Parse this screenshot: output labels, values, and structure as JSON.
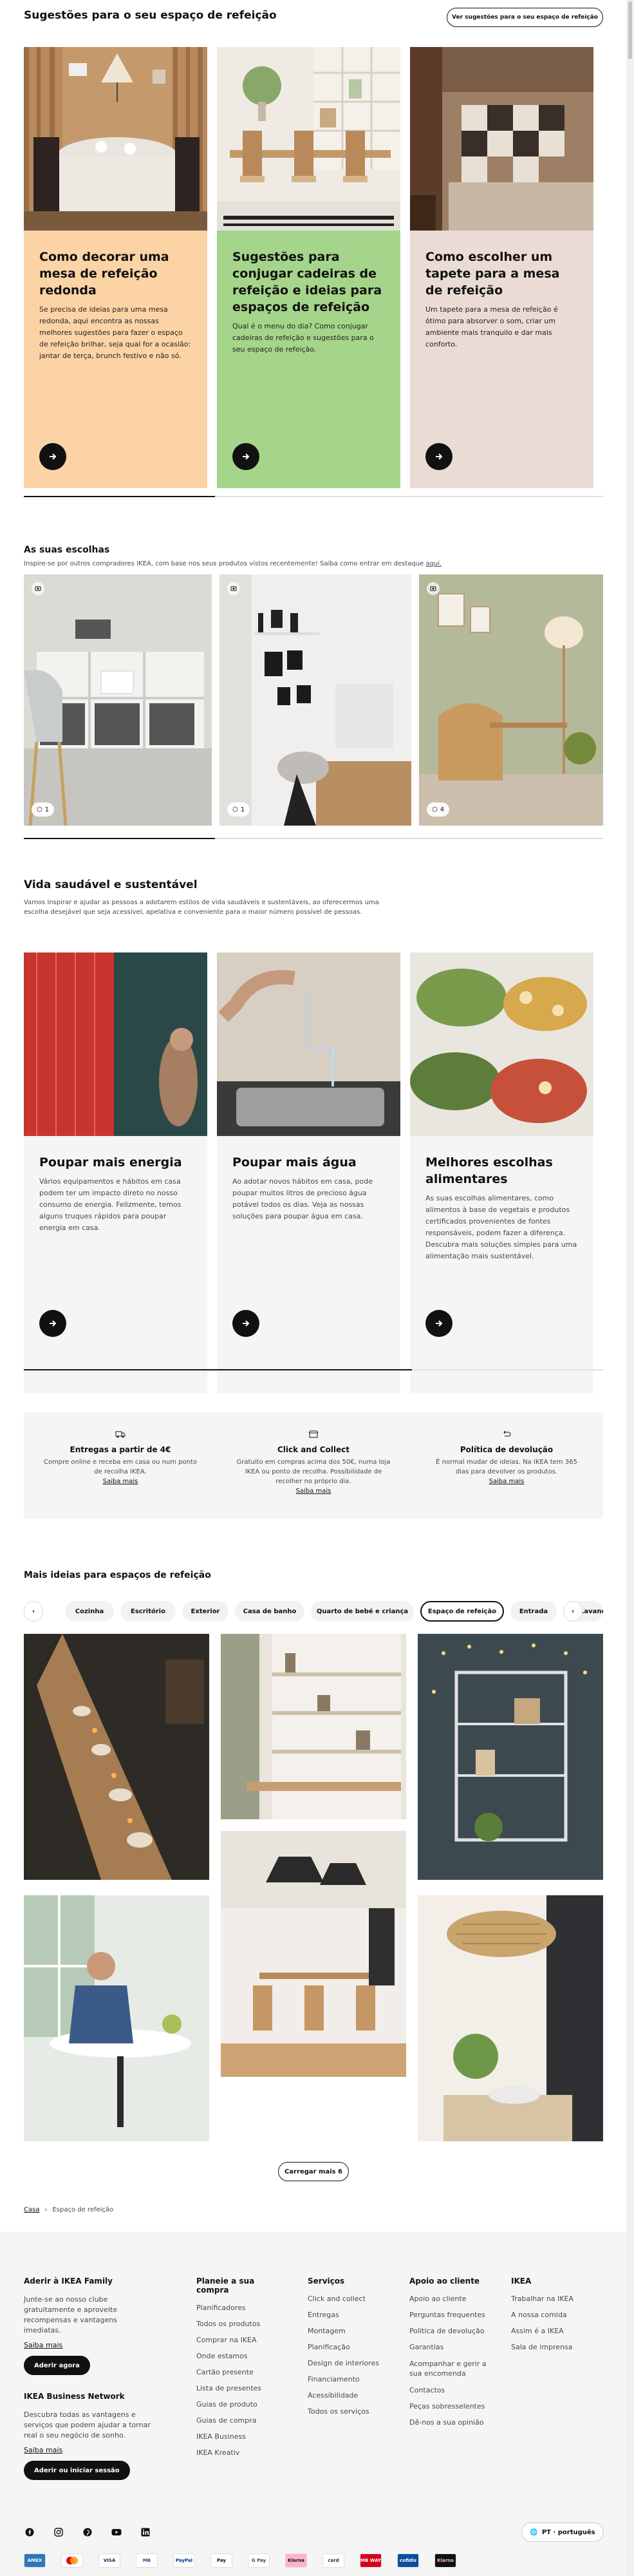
{
  "header": {
    "title": "Sugestões para o seu espaço de refeição",
    "cta": "Ver sugestões para o seu espaço de refeição"
  },
  "ideas": {
    "cards": [
      {
        "title": "Como decorar uma mesa de refeição redonda",
        "text": "Se precisa de ideias para uma mesa redonda, aqui encontra as nossas melhores sugestões para fazer o espaço de refeição brilhar, seja qual for a ocasião: jantar de terça, brunch festivo e não só.",
        "bg": "#fcd3a5"
      },
      {
        "title": "Sugestões para conjugar cadeiras de refeição e ideias para espaços de refeição",
        "text": "Qual é o menu do dia? Como conjugar cadeiras de refeição e sugestões para o seu espaço de refeição.",
        "bg": "#a5d58a"
      },
      {
        "title": "Como escolher um tapete para a mesa de refeição",
        "text": "Um tapete para a mesa de refeição é ótimo para absorver o som, criar um ambiente mais tranquilo e dar mais conforto.",
        "bg": "#eadcd4"
      }
    ],
    "progress": 0.33
  },
  "choices": {
    "title": "As suas escolhas",
    "subtitle": "Inspire-se por outros compradores IKEA, com base nos seus produtos vistos recentemente! Saiba como entrar em destaque",
    "subtitle_link": "aqui.",
    "items": [
      {
        "count": "1"
      },
      {
        "count": "1"
      },
      {
        "count": "4"
      }
    ],
    "progress": 0.33
  },
  "sustain": {
    "title": "Vida saudável e sustentável",
    "subtitle": "Vamos inspirar e ajudar as pessoas a adotarem estilos de vida saudáveis e sustentáveis, ao oferecermos uma escolha desejável que seja acessível, apelativa e conveniente para o maior número possível de pessoas.",
    "cards": [
      {
        "title": "Poupar mais energia",
        "text": "Vários equipamentos e hábitos em casa podem ter um impacto direto no nosso consumo de energia. Felizmente, temos alguns truques rápidos para poupar energia em casa."
      },
      {
        "title": "Poupar mais água",
        "text": "Ao adotar novos hábitos em casa, pode poupar muitos litros de precioso água potável todos os dias. Veja as nossas soluções para poupar água em casa."
      },
      {
        "title": "Melhores escolhas alimentares",
        "text": "As suas escolhas alimentares, como alimentos à base de vegetais e produtos certificados provenientes de fontes responsáveis, podem fazer a diferença. Descubra mais soluções simples para uma alimentação mais sustentável."
      }
    ],
    "progress": 0.67
  },
  "services": [
    {
      "icon": "truck-icon",
      "title": "Entregas a partir de 4€",
      "text": "Compre online e receba em casa ou num ponto de recolha IKEA.",
      "link": "Saiba mais"
    },
    {
      "icon": "store-icon",
      "title": "Click and Collect",
      "text": "Gratuito em compras acima dos 50€, numa loja IKEA ou ponto de recolha. Possibilidade de recolher no próprio dia.",
      "link": "Saiba mais"
    },
    {
      "icon": "return-icon",
      "title": "Política de devolução",
      "text": "É normal mudar de ideias. Na IKEA tem 365 dias para devolver os produtos.",
      "link": "Saiba mais"
    }
  ],
  "more": {
    "title": "Mais ideias para espaços de refeição",
    "chips": [
      "Cozinha",
      "Escritório",
      "Exterior",
      "Casa de banho",
      "Quarto de bebé e criança",
      "Espaço de refeição",
      "Entrada",
      "Lavandaria"
    ],
    "active": "Espaço de refeição",
    "load_more": "Carregar mais 6"
  },
  "breadcrumb": {
    "home": "Casa",
    "separator": "›",
    "current": "Espaço de refeição"
  },
  "footer": {
    "family_title": "Aderir à IKEA Family",
    "family_text": "Junte-se ao nosso clube gratuitamente e aproveite recompensas e vantagens imediatas.",
    "family_link": "Saiba mais",
    "family_btn": "Aderir agora",
    "business_title": "IKEA Business Network",
    "business_text": "Descubra todas as vantagens e serviços que podem ajudar a tornar real o seu negócio de sonho.",
    "business_link": "Saiba mais",
    "business_btn": "Aderir ou iniciar sessão",
    "columns": [
      {
        "title": "Planeie a sua compra",
        "items": [
          "Planificadores",
          "Todos os produtos",
          "Comprar na IKEA",
          "Onde estamos",
          "Cartão presente",
          "Lista de presentes",
          "Guias de produto",
          "Guias de compra",
          "IKEA Business",
          "IKEA Kreativ"
        ]
      },
      {
        "title": "Serviços",
        "items": [
          "Click and collect",
          "Entregas",
          "Montagem",
          "Planificação",
          "Design de interiores",
          "Financiamento",
          "Acessibilidade",
          "Todos os serviços"
        ]
      },
      {
        "title": "Apoio ao cliente",
        "items": [
          "Apoio ao cliente",
          "Perguntas frequentes",
          "Política de devolução",
          "Garantias",
          "Acompanhar e gerir a sua encomenda",
          "Contactos",
          "Peças sobresselentes",
          "Dê-nos a sua opinião"
        ]
      },
      {
        "title": "IKEA",
        "items": [
          "Trabalhar na IKEA",
          "A nossa comida",
          "Assim é a IKEA",
          "Sala de imprensa"
        ]
      }
    ],
    "language": "PT · português",
    "payments": [
      "AMEX",
      "MC",
      "VISA",
      "MB",
      "PayPal",
      "Pay",
      "G Pay",
      "Klarna",
      "card",
      "MB WAY",
      "cofidis",
      "Klarna"
    ]
  }
}
